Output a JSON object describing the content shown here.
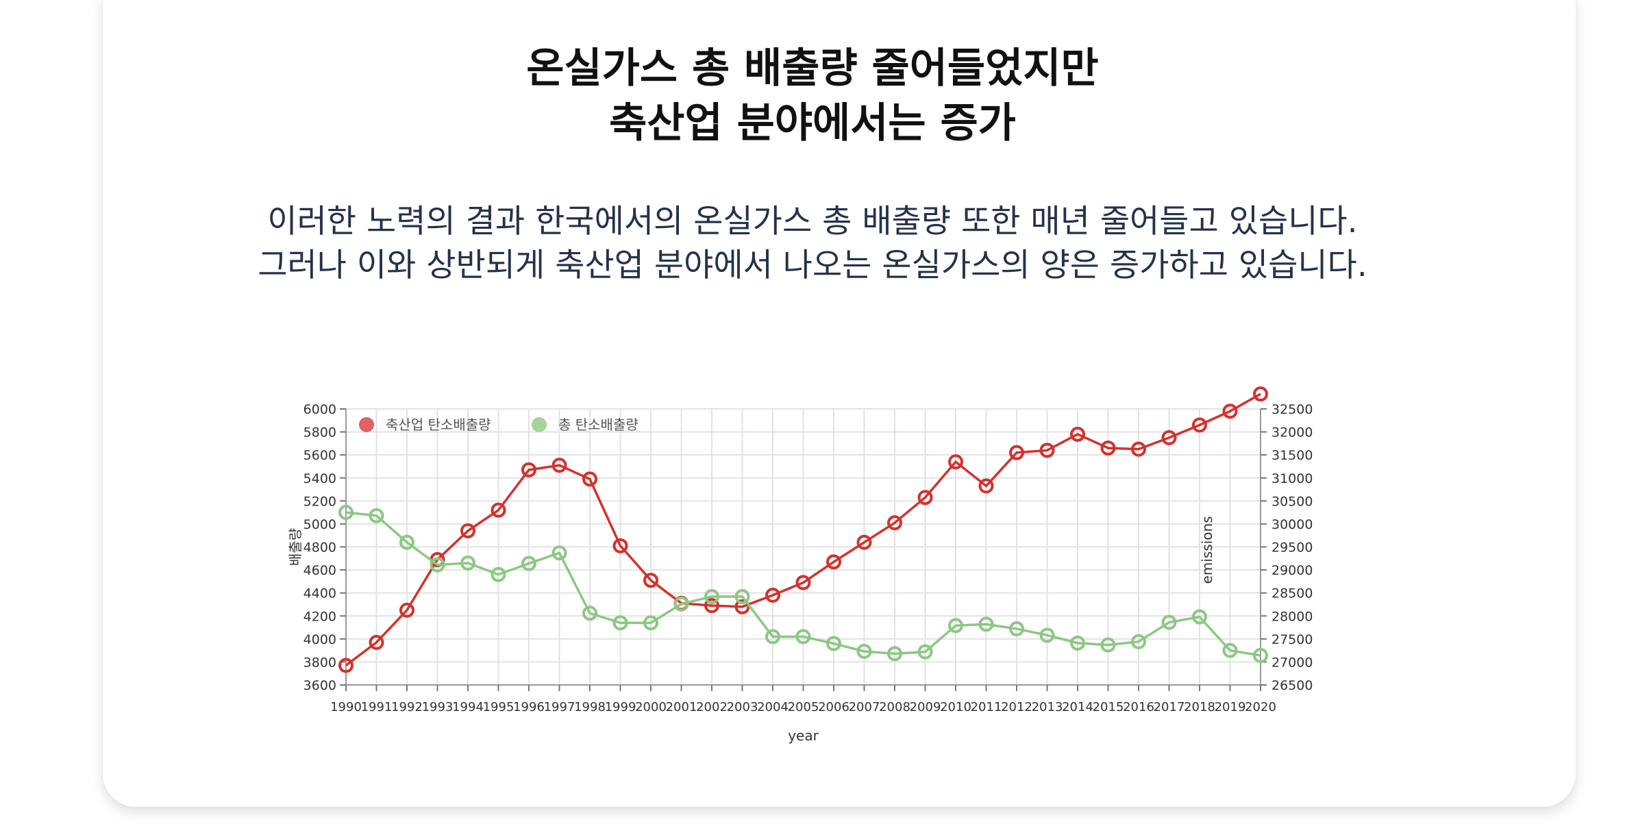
{
  "header": {
    "title_line1": "온실가스 총 배출량 줄어들었지만",
    "title_line2": "축산업 분야에서는 증가"
  },
  "description": {
    "line1": "이러한 노력의 결과 한국에서의 온실가스 총 배출량 또한 매년 줄어들고 있습니다.",
    "line2": "그러나 이와 상반되게 축산업 분야에서 나오는 온실가스의 양은 증가하고 있습니다."
  },
  "chart_data": {
    "type": "line",
    "title": "",
    "xlabel": "year",
    "ylabel": "배출량",
    "y2label": "emissions",
    "categories": [
      "1990",
      "1991",
      "1992",
      "1993",
      "1994",
      "1995",
      "1996",
      "1997",
      "1998",
      "1999",
      "2000",
      "2001",
      "2002",
      "2003",
      "2004",
      "2005",
      "2006",
      "2007",
      "2008",
      "2009",
      "2010",
      "2011",
      "2012",
      "2013",
      "2014",
      "2015",
      "2016",
      "2017",
      "2018",
      "2019",
      "2020"
    ],
    "ylim": [
      3600,
      6000
    ],
    "yticks": [
      3600,
      3800,
      4000,
      4200,
      4400,
      4600,
      4800,
      5000,
      5200,
      5400,
      5600,
      5800,
      6000
    ],
    "y2lim": [
      26500,
      32500
    ],
    "y2ticks": [
      26500,
      27000,
      27500,
      28000,
      28500,
      29000,
      29500,
      30000,
      30500,
      31000,
      31500,
      32000,
      32500
    ],
    "grid": true,
    "legend_position": "top-left",
    "series": [
      {
        "name": "축산업 탄소배출량",
        "axis": "left",
        "color": "#d2322d",
        "values": [
          3770,
          3970,
          4250,
          4690,
          4940,
          5120,
          5470,
          5510,
          5390,
          4810,
          4510,
          4310,
          4290,
          4280,
          4380,
          4490,
          4670,
          4840,
          5010,
          5230,
          5540,
          5330,
          5620,
          5640,
          5780,
          5660,
          5650,
          5750,
          5860,
          5980,
          6130
        ]
      },
      {
        "name": "총 탄소배출량",
        "axis": "right",
        "color": "#8cc783",
        "values": [
          30250,
          30180,
          29600,
          29110,
          29150,
          28900,
          29140,
          29370,
          28060,
          27850,
          27850,
          28260,
          28420,
          28420,
          27550,
          27550,
          27400,
          27230,
          27180,
          27220,
          27790,
          27820,
          27720,
          27580,
          27410,
          27370,
          27440,
          27860,
          27980,
          27250,
          27140
        ]
      }
    ]
  }
}
